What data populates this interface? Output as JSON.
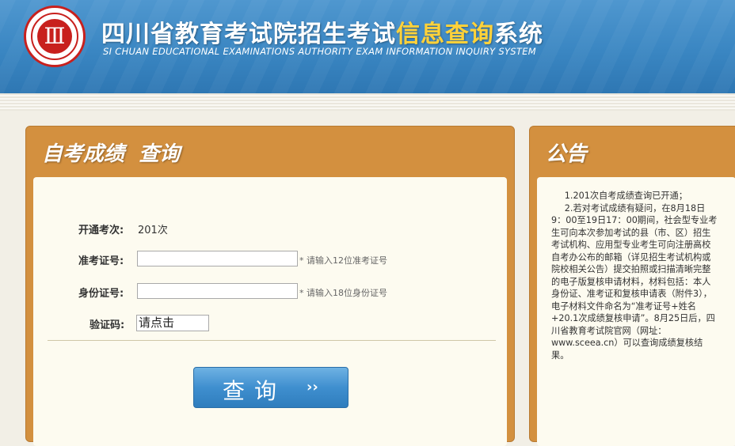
{
  "header": {
    "logo_name": "sceea-seal-logo",
    "title_main": "四川省教育考试院招生考试",
    "title_highlight": "信息查询",
    "title_tail": "系统",
    "title_en": "SI CHUAN EDUCATIONAL EXAMINATIONS AUTHORITY EXAM INFORMATION INQUIRY SYSTEM"
  },
  "query_panel": {
    "title": "自考成绩  查询",
    "exam_session_label": "开通考次:",
    "exam_session_value": "201次",
    "ticket_label": "准考证号:",
    "ticket_value": "",
    "ticket_hint": "* 请输入12位准考证号",
    "id_label": "身份证号:",
    "id_value": "",
    "id_hint": "* 请输入18位身份证号",
    "captcha_label": "验证码:",
    "captcha_text": "请点击",
    "submit_label": "查询",
    "submit_arrow": "››"
  },
  "notice_panel": {
    "title": "公告",
    "paragraphs": [
      "1.201次自考成绩查询已开通；",
      "2.若对考试成绩有疑问，在8月18日9：00至19日17：00期间，社会型专业考生可向本次参加考试的县（市、区）招生考试机构、应用型专业考生可向注册高校自考办公布的邮箱（详见招生考试机构或院校相关公告）提交拍照或扫描清晰完整的电子版复核申请材料，材料包括：本人身份证、准考证和复核申请表（附件3），电子材料文件命名为“准考证号+姓名+20.1次成绩复核申请”。8月25日后，四川省教育考试院官网（网址：www.sceea.cn）可以查询成绩复核结果。"
    ]
  },
  "colors": {
    "header_blue": "#3a86c2",
    "title_highlight": "#ffd23a",
    "panel_orange": "#d3903f",
    "panel_body": "#fdfbf0",
    "button_blue": "#3f8fcf"
  }
}
